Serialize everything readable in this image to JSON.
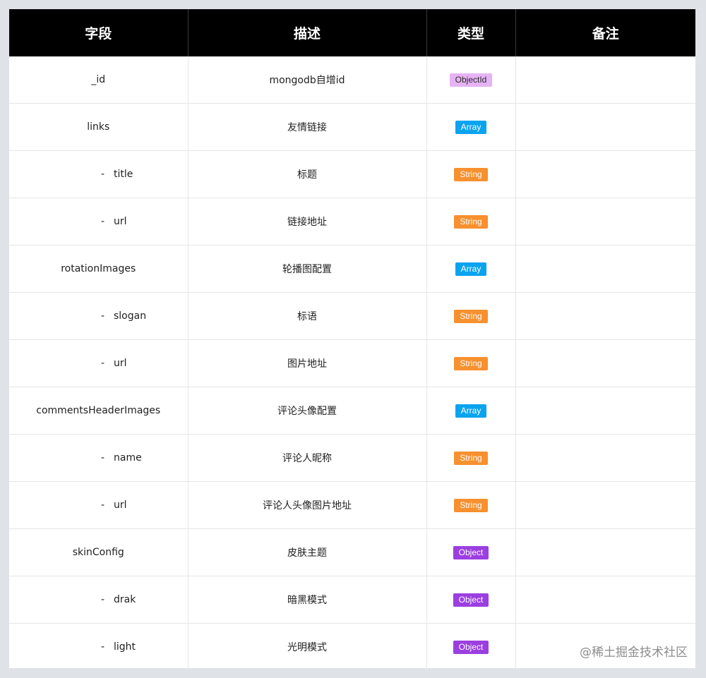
{
  "table": {
    "headers": [
      "字段",
      "描述",
      "类型",
      "备注"
    ],
    "rows": [
      {
        "field": "_id",
        "child": false,
        "desc": "mongodb自增id",
        "type": "ObjectId",
        "note": ""
      },
      {
        "field": "links",
        "child": false,
        "desc": "友情链接",
        "type": "Array",
        "note": ""
      },
      {
        "field": "title",
        "child": true,
        "desc": "标题",
        "type": "String",
        "note": ""
      },
      {
        "field": "url",
        "child": true,
        "desc": "链接地址",
        "type": "String",
        "note": ""
      },
      {
        "field": "rotationImages",
        "child": false,
        "desc": "轮播图配置",
        "type": "Array",
        "note": ""
      },
      {
        "field": "slogan",
        "child": true,
        "desc": "标语",
        "type": "String",
        "note": ""
      },
      {
        "field": "url",
        "child": true,
        "desc": "图片地址",
        "type": "String",
        "note": ""
      },
      {
        "field": "commentsHeaderImages",
        "child": false,
        "desc": "评论头像配置",
        "type": "Array",
        "note": ""
      },
      {
        "field": "name",
        "child": true,
        "desc": "评论人昵称",
        "type": "String",
        "note": ""
      },
      {
        "field": "url",
        "child": true,
        "desc": "评论人头像图片地址",
        "type": "String",
        "note": ""
      },
      {
        "field": "skinConfig",
        "child": false,
        "desc": "皮肤主题",
        "type": "Object",
        "note": ""
      },
      {
        "field": "drak",
        "child": true,
        "desc": "暗黑模式",
        "type": "Object",
        "note": ""
      },
      {
        "field": "light",
        "child": true,
        "desc": "光明模式",
        "type": "Object",
        "note": ""
      }
    ]
  },
  "child_prefix": "-",
  "type_colors": {
    "ObjectId": {
      "bg": "#e6b3f5",
      "fg": "#2b2b2b"
    },
    "Array": {
      "bg": "#0aa3f0",
      "fg": "#ffffff"
    },
    "String": {
      "bg": "#f7902e",
      "fg": "#ffffff"
    },
    "Object": {
      "bg": "#9b3fe0",
      "fg": "#ffffff"
    }
  },
  "watermark": "@稀土掘金技术社区"
}
